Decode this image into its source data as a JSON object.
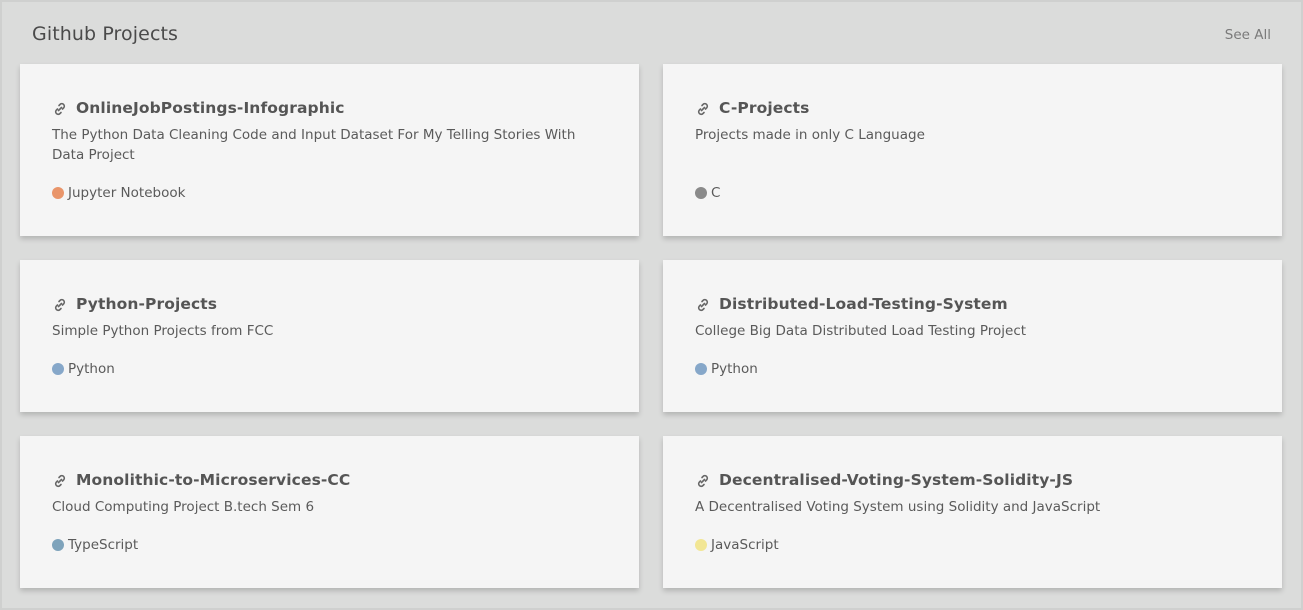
{
  "header": {
    "title": "Github Projects",
    "see_all": "See All"
  },
  "cards": [
    {
      "name": "OnlineJobPostings-Infographic",
      "description": "The Python Data Cleaning Code and Input Dataset For My Telling Stories With Data Project",
      "language": "Jupyter Notebook",
      "language_color": "#e9956a"
    },
    {
      "name": "C-Projects",
      "description": "Projects made in only C Language",
      "language": "C",
      "language_color": "#8a8a8a"
    },
    {
      "name": "Python-Projects",
      "description": "Simple Python Projects from FCC",
      "language": "Python",
      "language_color": "#86a7c9"
    },
    {
      "name": "Distributed-Load-Testing-System",
      "description": "College Big Data Distributed Load Testing Project",
      "language": "Python",
      "language_color": "#86a7c9"
    },
    {
      "name": "Monolithic-to-Microservices-CC",
      "description": "Cloud Computing Project B.tech Sem 6",
      "language": "TypeScript",
      "language_color": "#7ea3bb"
    },
    {
      "name": "Decentralised-Voting-System-Solidity-JS",
      "description": "A Decentralised Voting System using Solidity and JavaScript",
      "language": "JavaScript",
      "language_color": "#f2e694"
    }
  ],
  "icons": {
    "repo_link": "link-icon"
  }
}
